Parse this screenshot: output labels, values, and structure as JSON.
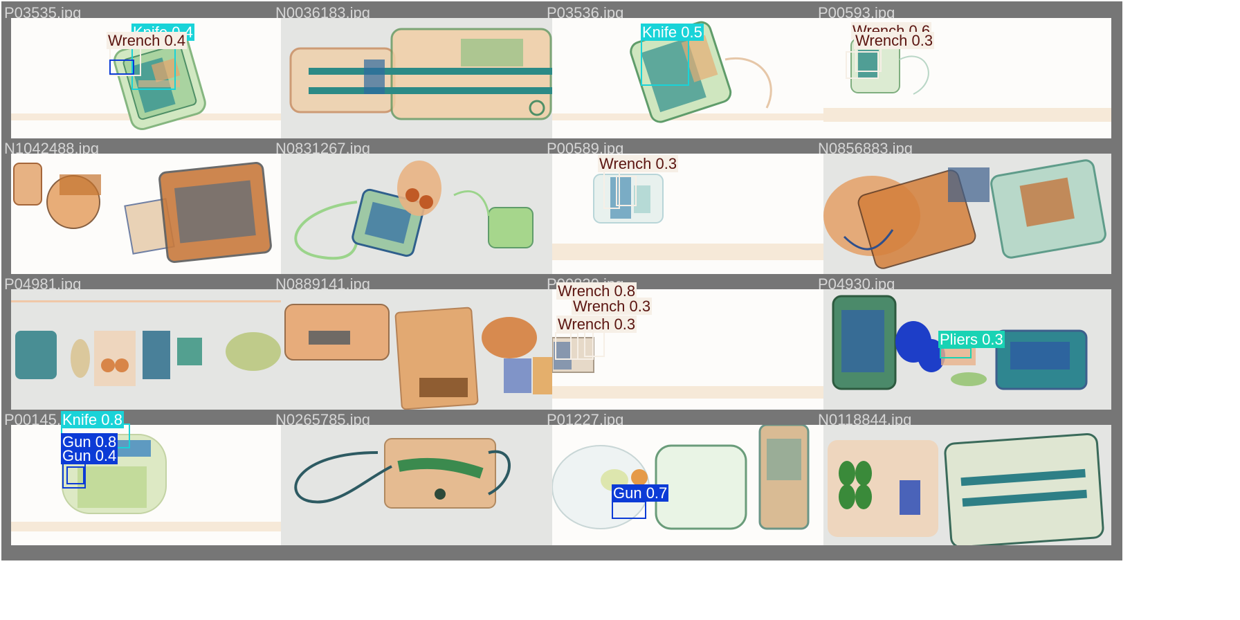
{
  "colors": {
    "gap": "#ffffff",
    "tile_bg": "#767676",
    "filename_text": "#d6d6d6",
    "photo_white": "#fdfcfa",
    "photo_gray": "#e4e5e3",
    "knife": "#19d3d8",
    "wrench_bg": "#f6efe6",
    "wrench_text": "#5a1410",
    "gun": "#0c3bd6",
    "pliers": "#19d3b4",
    "white_text": "#ffffff"
  },
  "tiles": [
    {
      "name": "P03535.jpg",
      "bg": "white",
      "scene": "case",
      "dets": [
        {
          "label": "Knife 0.4",
          "cls": "knife"
        },
        {
          "label": "Wrench 0.4",
          "cls": "wrench"
        },
        {
          "label": "",
          "cls": "knife"
        },
        {
          "label": "",
          "cls": "wrench"
        },
        {
          "label": "",
          "cls": "gun"
        }
      ]
    },
    {
      "name": "N0036183.jpg",
      "bg": "gray",
      "scene": "trolley",
      "dets": []
    },
    {
      "name": "P03536.jpg",
      "bg": "white",
      "scene": "case",
      "dets": [
        {
          "label": "Knife 0.5",
          "cls": "knife"
        }
      ]
    },
    {
      "name": "P00593.jpg",
      "bg": "white",
      "scene": "small",
      "dets": [
        {
          "label": "Wrench 0.6",
          "cls": "wrench"
        },
        {
          "label": "Wrench 0.3",
          "cls": "wrench"
        },
        {
          "label": "",
          "cls": "wrench"
        }
      ]
    },
    {
      "name": "N1042488.jpg",
      "bg": "white",
      "scene": "multi",
      "dets": []
    },
    {
      "name": "N0831267.jpg",
      "bg": "gray",
      "scene": "bag",
      "dets": []
    },
    {
      "name": "P00589.jpg",
      "bg": "white",
      "scene": "small",
      "dets": [
        {
          "label": "Wrench 0.3",
          "cls": "wrench"
        },
        {
          "label": "",
          "cls": "wrench"
        },
        {
          "label": "",
          "cls": "wrench"
        }
      ]
    },
    {
      "name": "N0856883.jpg",
      "bg": "gray",
      "scene": "multi",
      "dets": []
    },
    {
      "name": "P04981.jpg",
      "bg": "gray",
      "scene": "row",
      "dets": []
    },
    {
      "name": "N0889141.jpg",
      "bg": "gray",
      "scene": "bag",
      "dets": []
    },
    {
      "name": "P00830.jpg",
      "bg": "white",
      "scene": "edge",
      "dets": [
        {
          "label": "Wrench 0.8",
          "cls": "wrench"
        },
        {
          "label": "Wrench 0.3",
          "cls": "wrench"
        },
        {
          "label": "Wrench 0.3",
          "cls": "wrench"
        },
        {
          "label": "",
          "cls": "wrench"
        }
      ]
    },
    {
      "name": "P04930.jpg",
      "bg": "gray",
      "scene": "multi",
      "dets": [
        {
          "label": "Pliers 0.3",
          "cls": "pliers"
        }
      ]
    },
    {
      "name": "P00145.jpg",
      "bg": "white",
      "scene": "case",
      "dets": [
        {
          "label": "Knife 0.8",
          "cls": "knife"
        },
        {
          "label": "Gun 0.8",
          "cls": "gun"
        },
        {
          "label": "Gun 0.4",
          "cls": "gun"
        },
        {
          "label": "",
          "cls": "gun"
        }
      ]
    },
    {
      "name": "N0265785.jpg",
      "bg": "gray",
      "scene": "cable",
      "dets": []
    },
    {
      "name": "P01227.jpg",
      "bg": "white",
      "scene": "multi",
      "dets": [
        {
          "label": "Gun 0.7",
          "cls": "gun"
        }
      ]
    },
    {
      "name": "N0118844.jpg",
      "bg": "gray",
      "scene": "trolley",
      "dets": []
    }
  ]
}
